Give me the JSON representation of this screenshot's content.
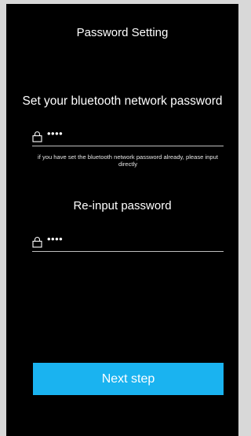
{
  "header": {
    "title": "Password Setting"
  },
  "form": {
    "prompt": "Set your bluetooth network password",
    "password_value": "••••",
    "hint": "if you have set the bluetooth network password already, please input directly",
    "reinput_label": "Re-input password",
    "reinput_value": "••••"
  },
  "actions": {
    "next_label": "Next step"
  },
  "colors": {
    "background": "#000000",
    "accent": "#1ab3f0",
    "text": "#ffffff"
  }
}
